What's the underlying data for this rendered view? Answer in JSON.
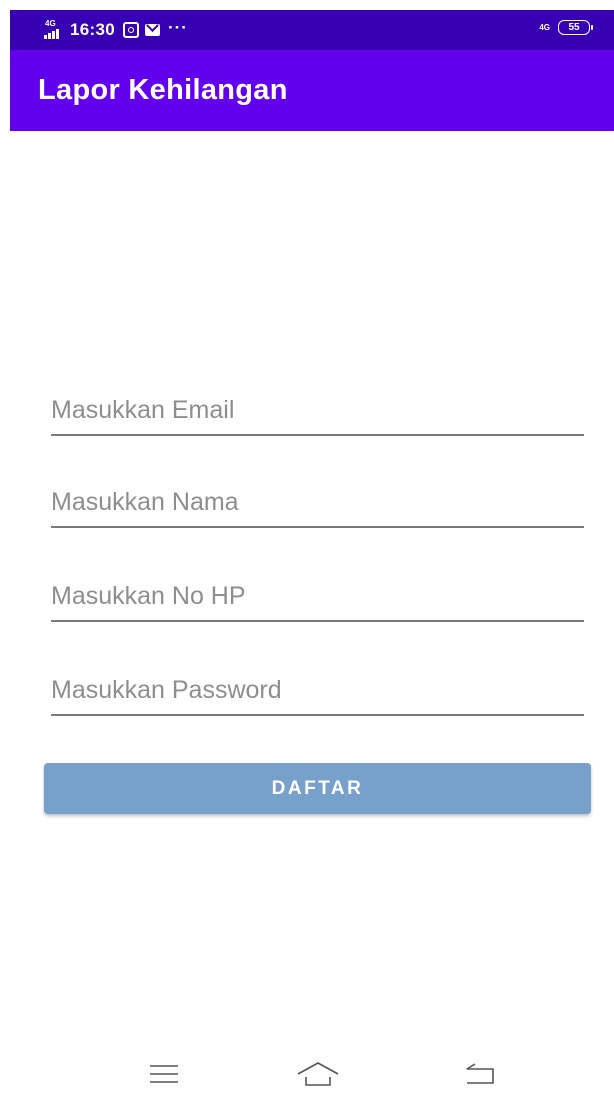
{
  "status_bar": {
    "network_left": "4G",
    "time": "16:30",
    "more": "···",
    "network_right": "4G",
    "battery": "55",
    "icons": [
      "signal-4g-icon",
      "instagram-icon",
      "mail-icon",
      "more-icon",
      "network-4g-icon",
      "battery-icon"
    ]
  },
  "app_bar": {
    "title": "Lapor Kehilangan",
    "color": "#6200ee"
  },
  "form": {
    "email_placeholder": "Masukkan Email",
    "email_value": "",
    "name_placeholder": "Masukkan Nama",
    "name_value": "",
    "phone_placeholder": "Masukkan No HP",
    "phone_value": "",
    "password_placeholder": "Masukkan Password",
    "password_value": "",
    "submit_label": "DAFTAR",
    "submit_color": "#77a0ca"
  },
  "nav_bar": {
    "icons": [
      "menu-icon",
      "home-icon",
      "back-icon"
    ]
  }
}
